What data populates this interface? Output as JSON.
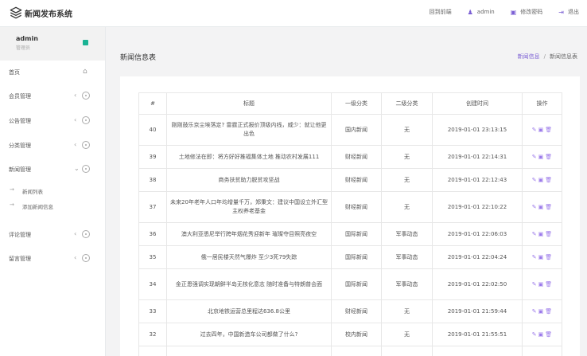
{
  "app": {
    "title": "新闻发布系统",
    "logo_icon": "layers-icon"
  },
  "topnav": [
    {
      "label": "回到前端",
      "icon": "home-icon"
    },
    {
      "label": "admin",
      "icon": "user-icon"
    },
    {
      "label": "修改密码",
      "icon": "key-icon"
    },
    {
      "label": "退出",
      "icon": "logout-icon"
    }
  ],
  "profile": {
    "name": "admin",
    "role": "管理员"
  },
  "sidebar": {
    "items": [
      {
        "label": "首页"
      },
      {
        "label": "会员管理"
      },
      {
        "label": "公告管理"
      },
      {
        "label": "分类管理"
      },
      {
        "label": "新闻管理"
      },
      {
        "label": "评论管理"
      },
      {
        "label": "留言管理"
      }
    ],
    "subitems": [
      {
        "label": "新闻列表"
      },
      {
        "label": "添加新闻信息"
      }
    ]
  },
  "page": {
    "title": "新闻信息表"
  },
  "breadcrumb": {
    "link": "新闻信息",
    "sep": "/",
    "current": "新闻信息表"
  },
  "table": {
    "headers": [
      "#",
      "标题",
      "一级分类",
      "二级分类",
      "创建时间",
      "操作"
    ],
    "rows": [
      {
        "id": "40",
        "title": "刚刚鼓乐京尘埃落定? 雷霆正式报价顶级内线，威少：就让他更出色",
        "cat1": "国内新闻",
        "cat2": "无",
        "time": "2019-01-01 23:13:15"
      },
      {
        "id": "39",
        "title": "土地修法在即：将方好好推福集体土地 推动农村发展111",
        "cat1": "财经新闻",
        "cat2": "无",
        "time": "2019-01-01 22:14:31"
      },
      {
        "id": "38",
        "title": "商务扶贫助力脱贫攻坚战",
        "cat1": "财经新闻",
        "cat2": "无",
        "time": "2019-01-01 22:12:43"
      },
      {
        "id": "37",
        "title": "未来20年老年人口年均增量千万，郑秉文：建议中国设立外汇型主权养老基金",
        "cat1": "财经新闻",
        "cat2": "无",
        "time": "2019-01-01 22:10:22"
      },
      {
        "id": "36",
        "title": "澳大利亚悉尼举行跨年烟花秀迎新年 璀璨夺目照亮夜空",
        "cat1": "国际新闻",
        "cat2": "军事动态",
        "time": "2019-01-01 22:06:03"
      },
      {
        "id": "35",
        "title": "俄一居民楼天然气爆炸 至少3死79失踪",
        "cat1": "国际新闻",
        "cat2": "军事动态",
        "time": "2019-01-01 22:04:24"
      },
      {
        "id": "34",
        "title": "金正恩强调实现朝鲜半岛无核化意志 随时准备与特朗普会面",
        "cat1": "国际新闻",
        "cat2": "军事动态",
        "time": "2019-01-01 22:02:50"
      },
      {
        "id": "33",
        "title": "北京地铁运营总里程达636.8公里",
        "cat1": "财经新闻",
        "cat2": "无",
        "time": "2019-01-01 21:59:44"
      },
      {
        "id": "32",
        "title": "过去四年，中国新造车公司都做了什么?",
        "cat1": "校内新闻",
        "cat2": "无",
        "time": "2019-01-01 21:55:51"
      }
    ],
    "actions": {
      "edit": "✎",
      "view": "▣",
      "delete": "🗑"
    }
  }
}
